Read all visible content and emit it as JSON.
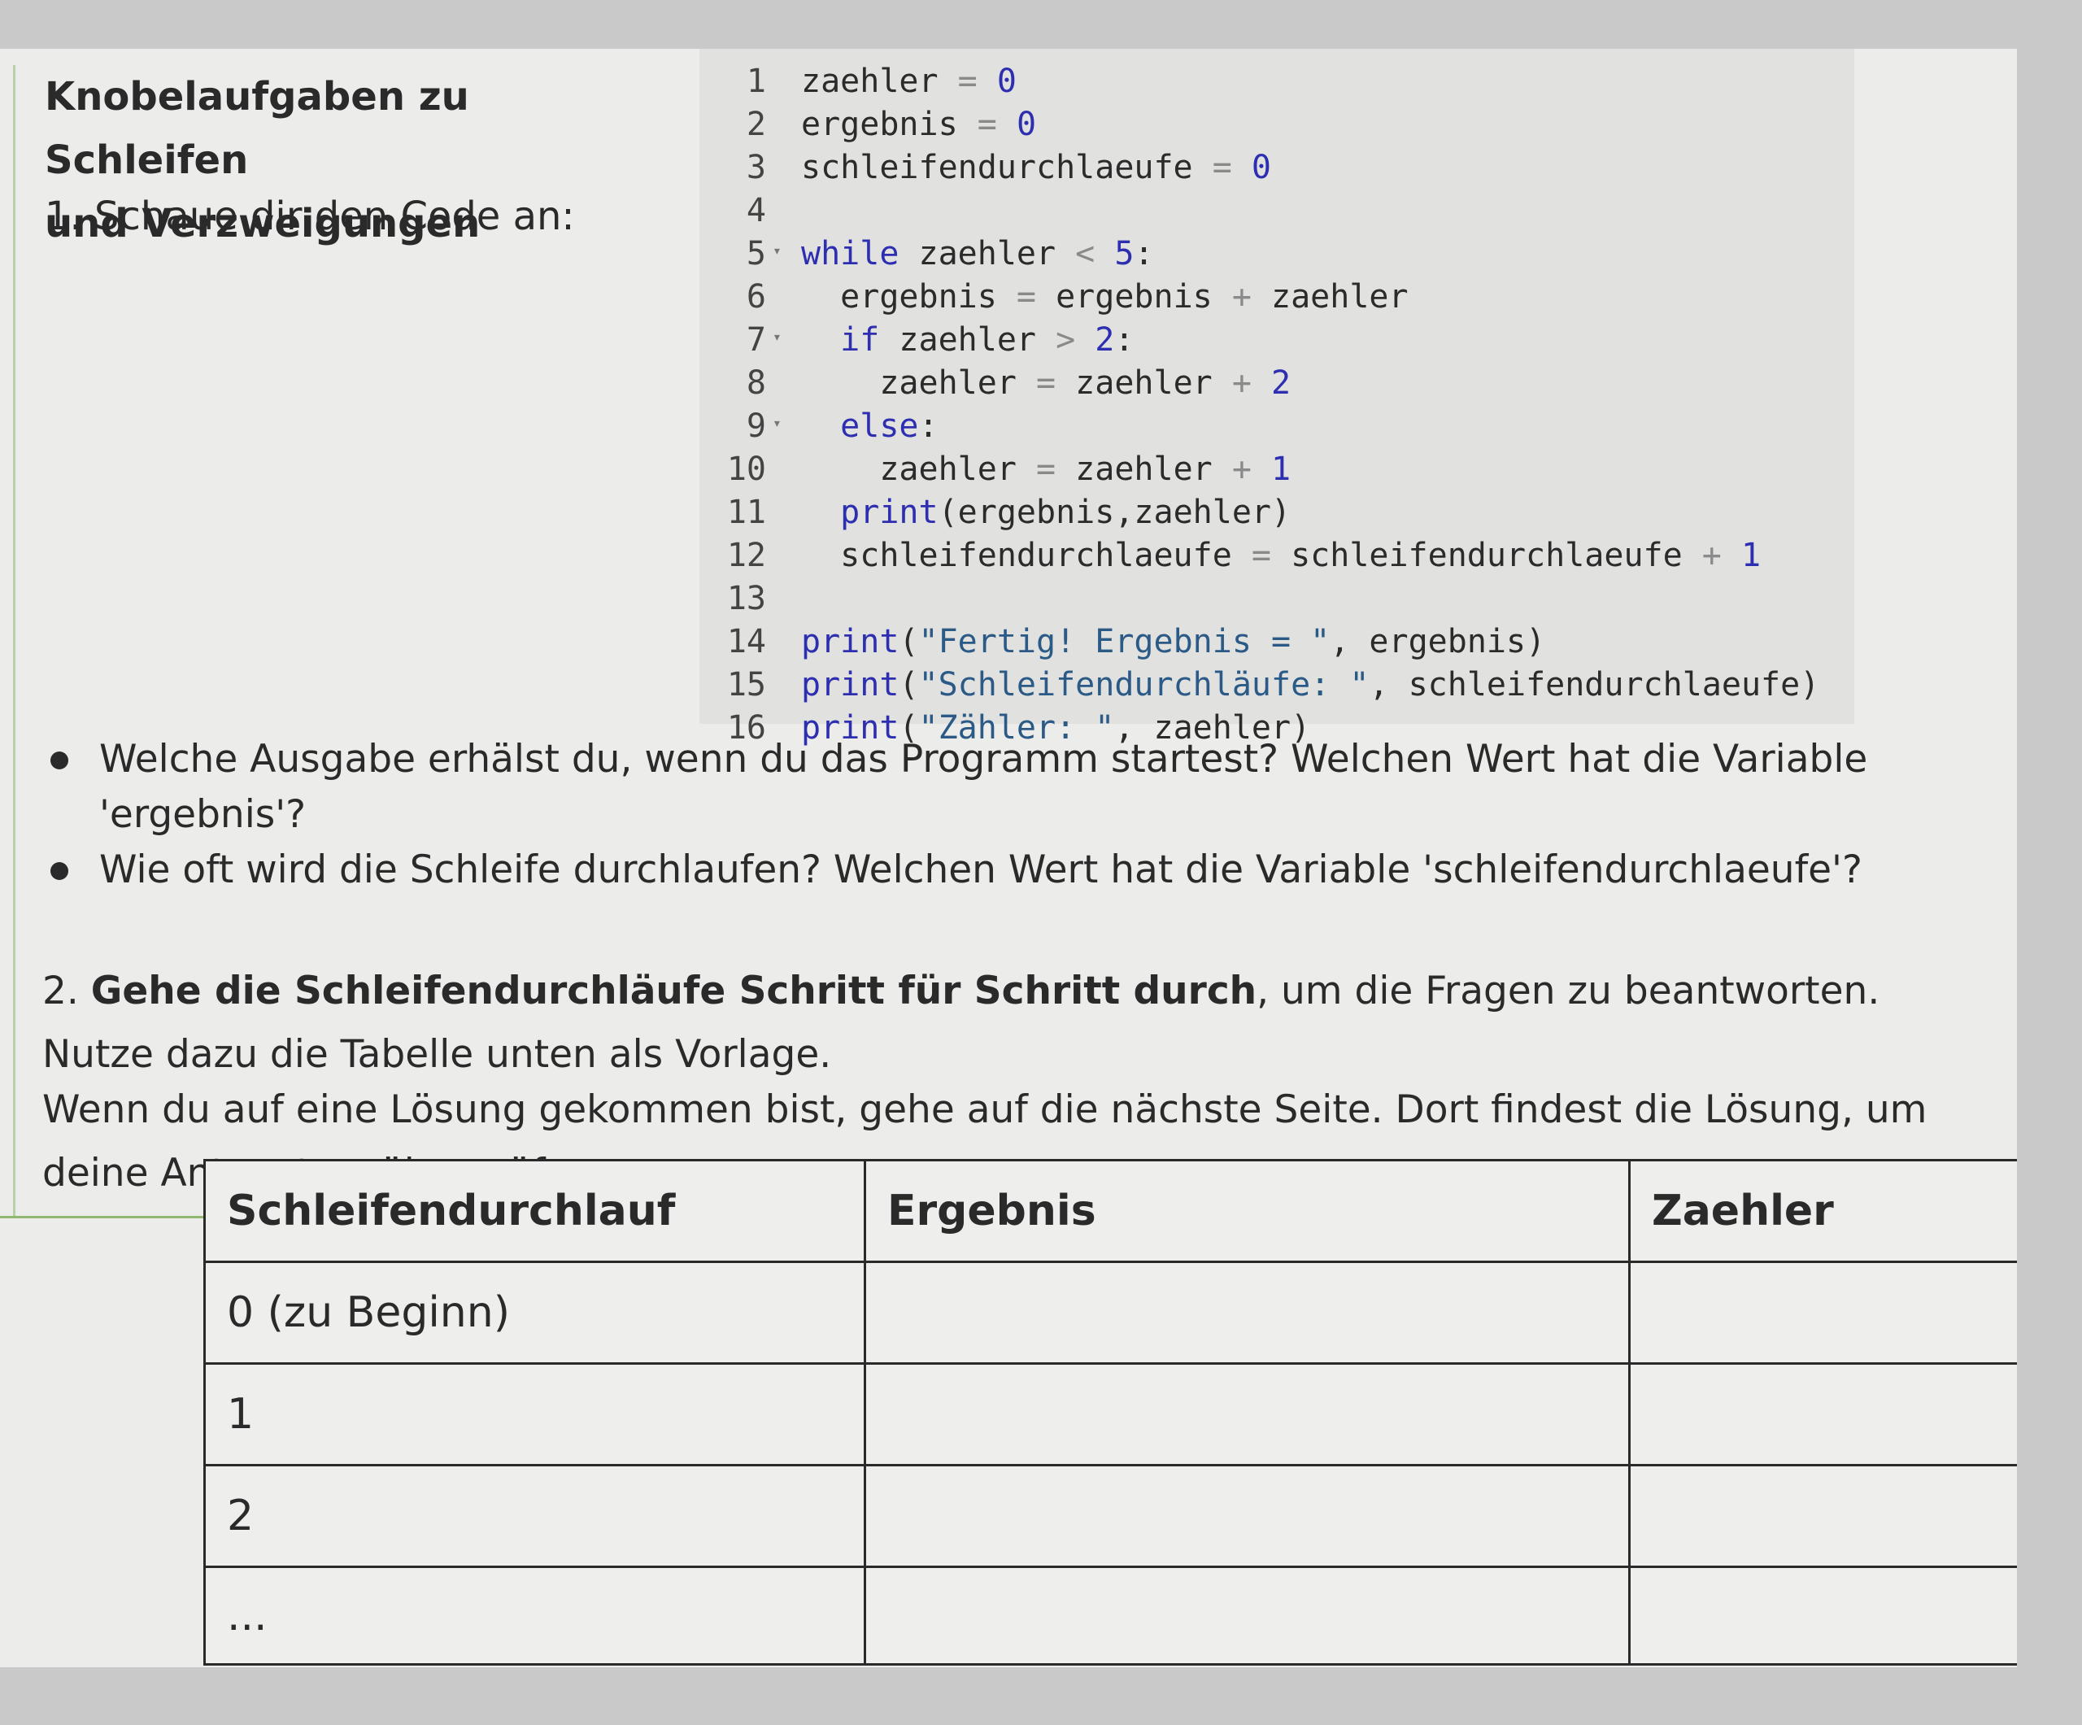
{
  "header": {
    "title_line1": "Knobelaufgaben zu Schleifen",
    "title_line2": "und Verzweigungen"
  },
  "task1": {
    "label": "1.  Schaue dir den Code an:"
  },
  "code": [
    {
      "n": "1",
      "text": "zaehler = 0"
    },
    {
      "n": "2",
      "text": "ergebnis = 0"
    },
    {
      "n": "3",
      "text": "schleifendurchlaeufe = 0"
    },
    {
      "n": "4",
      "text": ""
    },
    {
      "n": "5",
      "text": "while zaehler < 5:"
    },
    {
      "n": "6",
      "text": "  ergebnis = ergebnis + zaehler"
    },
    {
      "n": "7",
      "text": "  if zaehler > 2:"
    },
    {
      "n": "8",
      "text": "    zaehler = zaehler + 2"
    },
    {
      "n": "9",
      "text": "  else:"
    },
    {
      "n": "10",
      "text": "    zaehler = zaehler + 1"
    },
    {
      "n": "11",
      "text": "  print(ergebnis,zaehler)"
    },
    {
      "n": "12",
      "text": "  schleifendurchlaeufe = schleifendurchlaeufe + 1"
    },
    {
      "n": "13",
      "text": ""
    },
    {
      "n": "14",
      "text": "print(\"Fertig! Ergebnis = \", ergebnis)"
    },
    {
      "n": "15",
      "text": "print(\"Schleifendurchläufe: \", schleifendurchlaeufe)"
    },
    {
      "n": "16",
      "text": "print(\"Zähler: \", zaehler)"
    }
  ],
  "questions": [
    "Welche Ausgabe erhälst du, wenn du das Programm startest? Welchen Wert hat die Variable 'ergebnis'?",
    "Wie oft wird die Schleife durchlaufen? Welchen Wert hat die Variable 'schleifendurchlaeufe'?"
  ],
  "task2": {
    "number": "2.",
    "bold": "Gehe die Schleifendurchläufe Schritt für Schritt durch",
    "rest": ", um die Fragen zu beantworten. Nutze dazu die Tabelle unten als Vorlage."
  },
  "task3": {
    "text": "Wenn du auf eine Lösung gekommen bist, gehe auf die nächste Seite. Dort findest die Lösung, um deine Antwort ",
    "struck": "zu überprüfen."
  },
  "table": {
    "headers": [
      "Schleifendurchlauf",
      "Ergebnis",
      "Zaehler"
    ],
    "rows": [
      [
        "0 (zu Beginn)",
        "",
        ""
      ],
      [
        "1",
        "",
        ""
      ],
      [
        "2",
        "",
        ""
      ],
      [
        "...",
        "",
        ""
      ]
    ]
  }
}
